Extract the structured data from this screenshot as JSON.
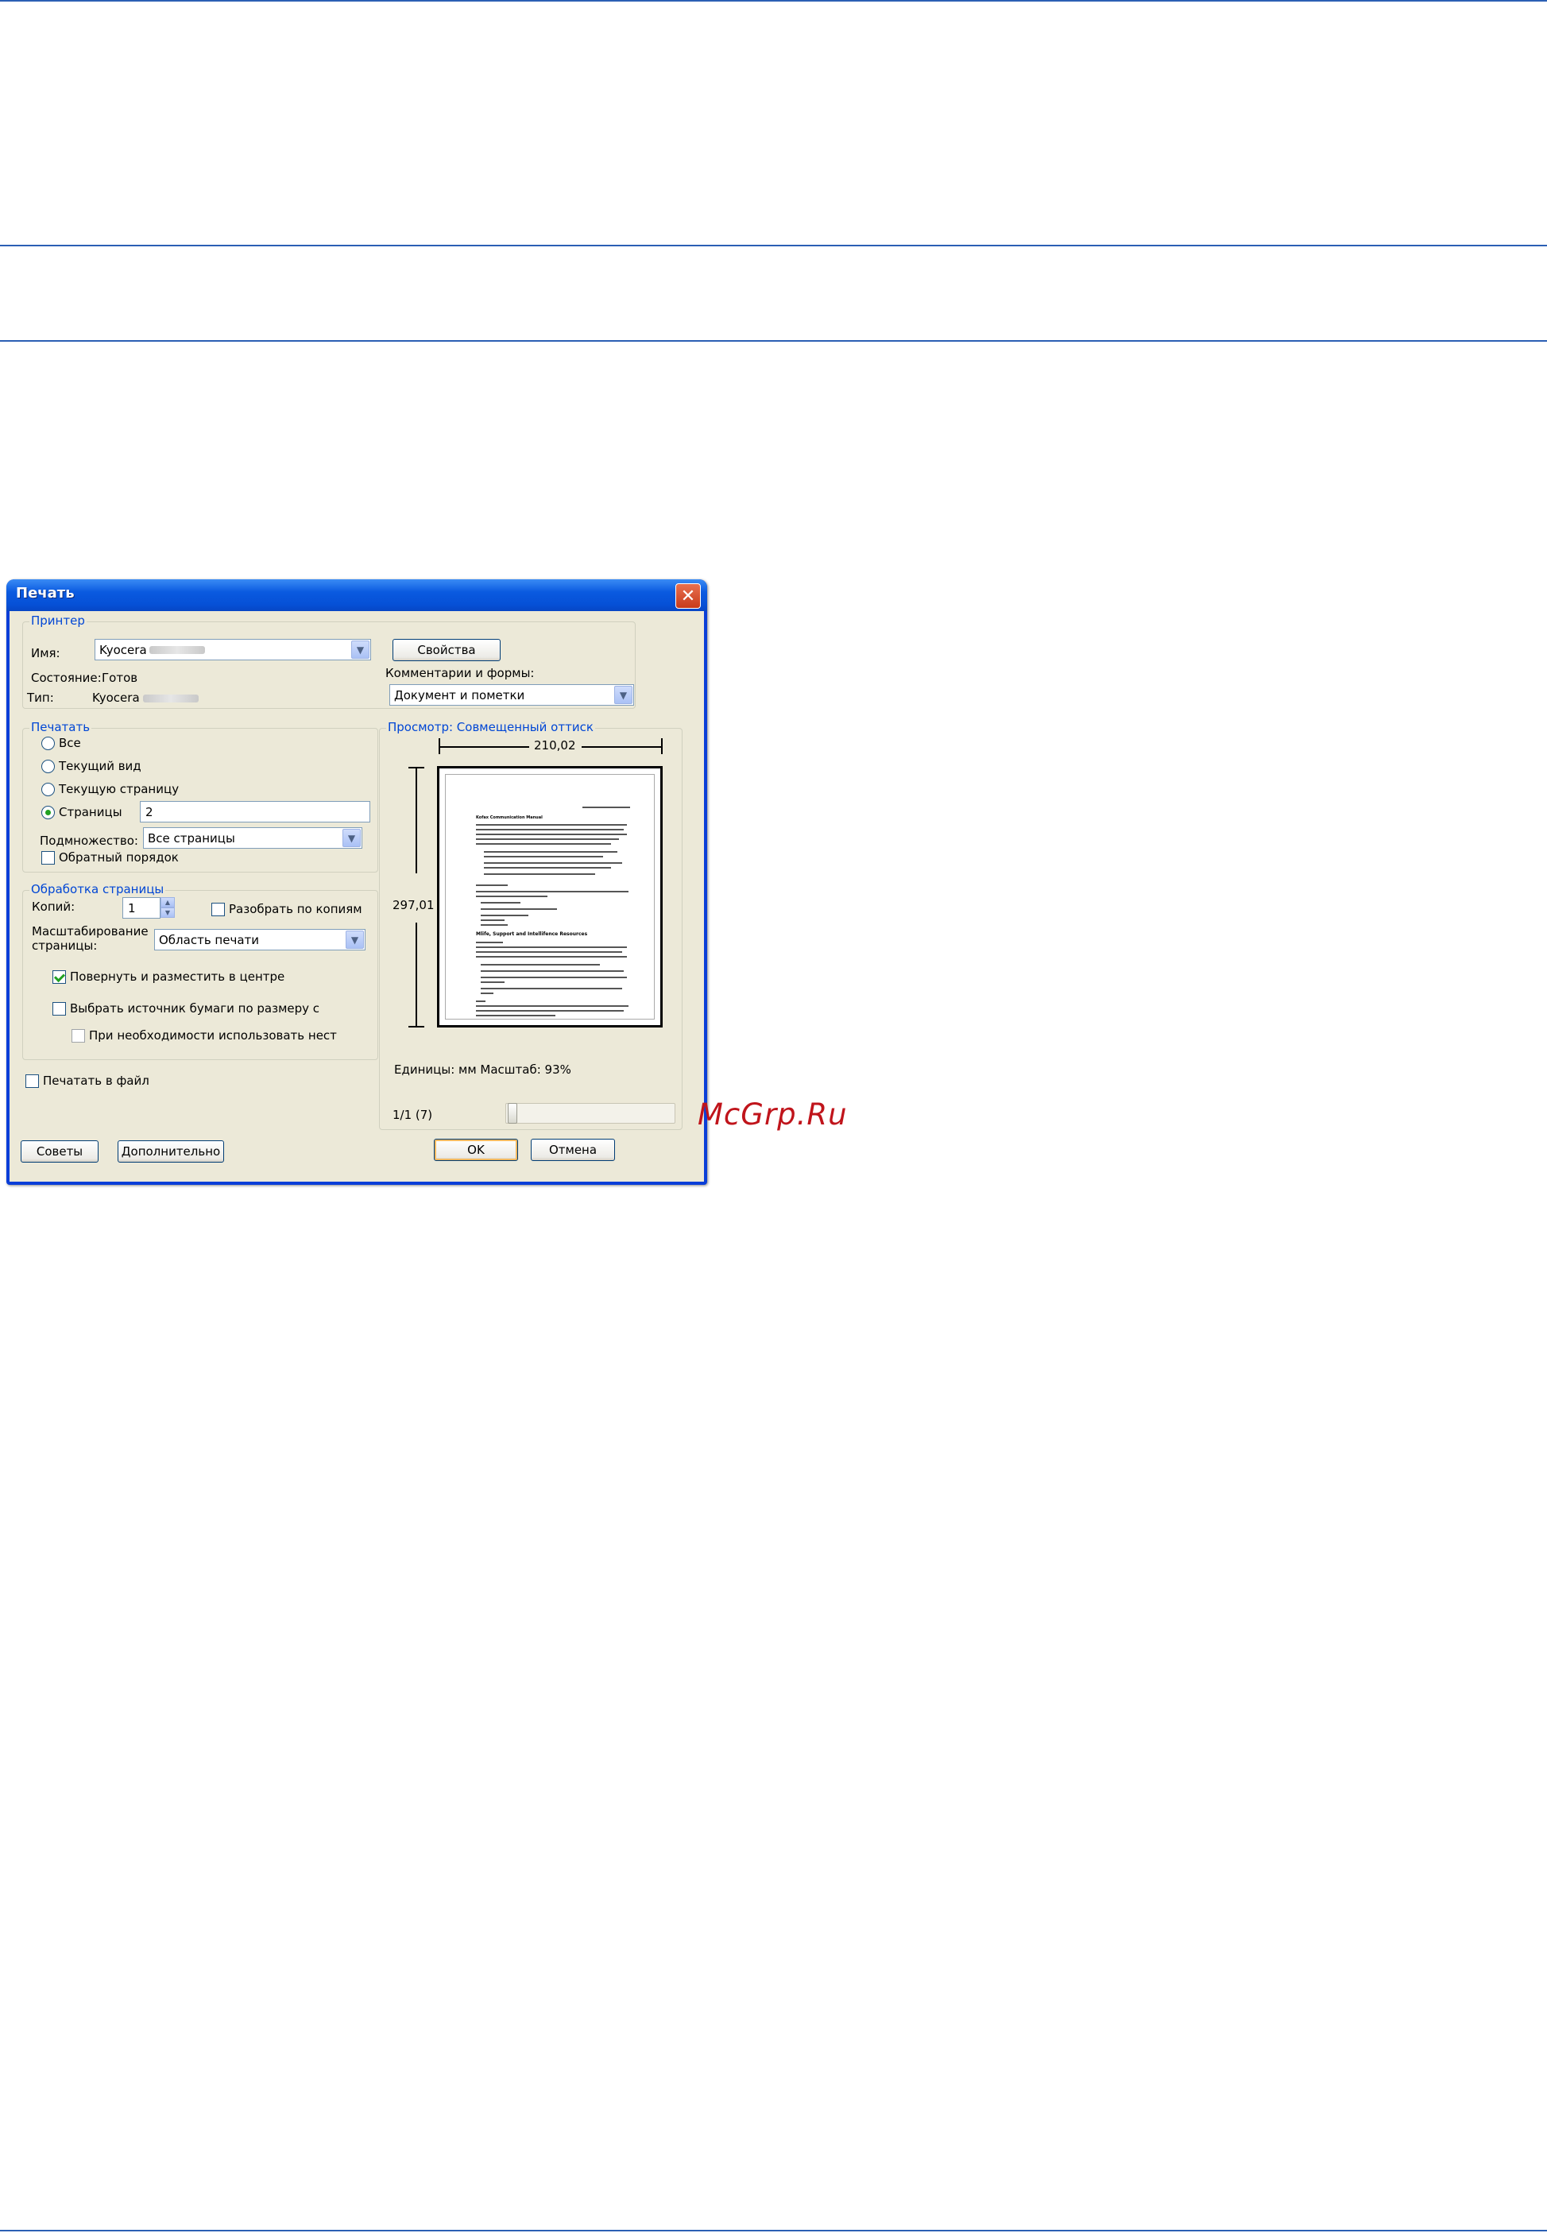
{
  "dialog": {
    "title": "Печать",
    "close_glyph": "✕",
    "printer_group": {
      "legend": "Принтер",
      "name_label": "Имя:",
      "name_value": "Kyocera",
      "status_label": "Состояние:",
      "status_value": "Готов",
      "type_label": "Тип:",
      "type_value": "Kyocera",
      "properties_button": "Свойства",
      "comments_label": "Комментарии и формы:",
      "comments_value": "Документ и пометки"
    },
    "print_group": {
      "legend": "Печатать",
      "options": [
        "Все",
        "Текущий вид",
        "Текущую страницу",
        "Страницы"
      ],
      "selected_option": "Страницы",
      "pages_value": "2",
      "subset_label": "Подмножество:",
      "subset_value": "Все страницы",
      "reverse_label": "Обратный порядок",
      "reverse_checked": false
    },
    "page_handling_group": {
      "legend": "Обработка страницы",
      "copies_label": "Копий:",
      "copies_value": "1",
      "collate_label": "Разобрать по копиям",
      "collate_checked": false,
      "scaling_label_line1": "Масштабирование",
      "scaling_label_line2": "страницы:",
      "scaling_value": "Область печати",
      "autorotate_label": "Повернуть и разместить в центре",
      "autorotate_checked": true,
      "paper_source_label": "Выбрать источник бумаги по размеру с",
      "paper_source_checked": false,
      "custom_paper_label": "При необходимости использовать нест",
      "custom_paper_checked": false
    },
    "print_to_file_label": "Печатать в файл",
    "print_to_file_checked": false,
    "preview_group": {
      "legend": "Просмотр: Совмещенный оттиск",
      "width_value": "210,02",
      "height_value": "297,01",
      "units_text": "Единицы: мм Масштаб:  93%",
      "page_counter": "1/1 (7)",
      "doc_heading_1": "Kofax Communication Manual",
      "doc_heading_2": "Mlife, Support and Intellifence Resources"
    },
    "buttons": {
      "tips": "Советы",
      "advanced": "Дополнительно",
      "ok": "OK",
      "cancel": "Отмена"
    }
  },
  "watermark": "McGrp.Ru",
  "colors": {
    "rule": "#2b5fb4",
    "dialog_face": "#ece9d8",
    "title_bar": "#0a5ae0",
    "legend_text": "#0046d5",
    "watermark": "#c0141b"
  }
}
